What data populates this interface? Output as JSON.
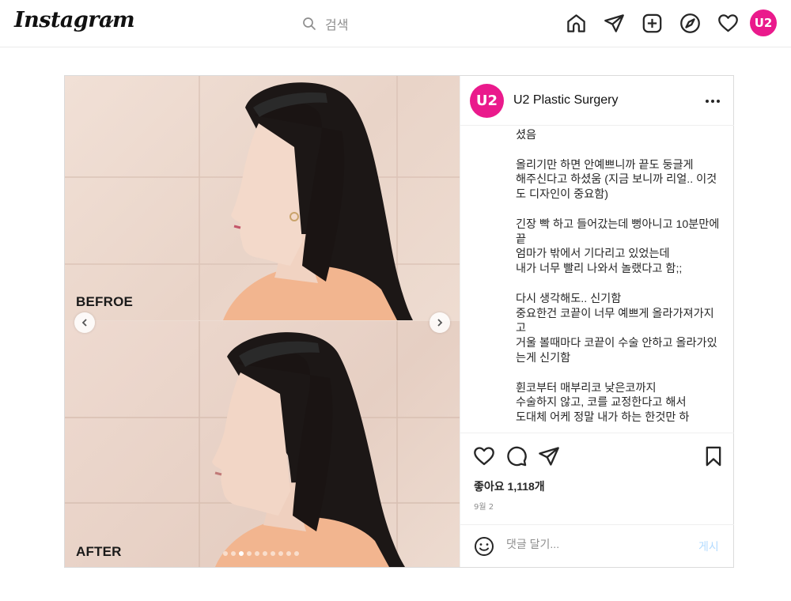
{
  "nav": {
    "brand": "Instagram",
    "search_placeholder": "검색",
    "profile_initials": "U2",
    "icons": [
      "home-icon",
      "send-icon",
      "new-post-icon",
      "explore-icon",
      "activity-heart-icon"
    ]
  },
  "post": {
    "author": {
      "name": "U2 Plastic Surgery",
      "avatar_initials": "U2"
    },
    "media": {
      "before_label": "BEFROE",
      "after_label": "AFTER",
      "slide_count": 10,
      "active_slide": 3
    },
    "caption": "셨음\n\n올리기만 하면 안예쁘니까 끝도 둥글게\n해주신다고 하셨움 (지금 보니까 리얼.. 이것도 디자인이 중요함)\n\n긴장 빡 하고 들어갔는데 뻥아니고 10분만에 끝\n엄마가 밖에서 기다리고 있었는데\n내가 너무 빨리 나와서 놀랬다고 함;;\n\n다시 생각해도.. 신기함\n중요한건 코끝이 너무 예쁘게 올라가져가지고\n거울 볼때마다 코끝이 수술 안하고 올라가있는게 신기함\n\n휜코부터 매부리코 낮은코까지\n수술하지 않고, 코를 교정한다고 해서\n도대체 어케 정말 내가 하는 한것만 하",
    "likes": "좋아요 1,118개",
    "date": "9월 2",
    "comment_placeholder": "댓글 달기...",
    "post_button": "게시"
  },
  "colors": {
    "brand_pink": "#ea1a8c",
    "post_button": "#b3dbff",
    "border": "#dbdbdb"
  }
}
